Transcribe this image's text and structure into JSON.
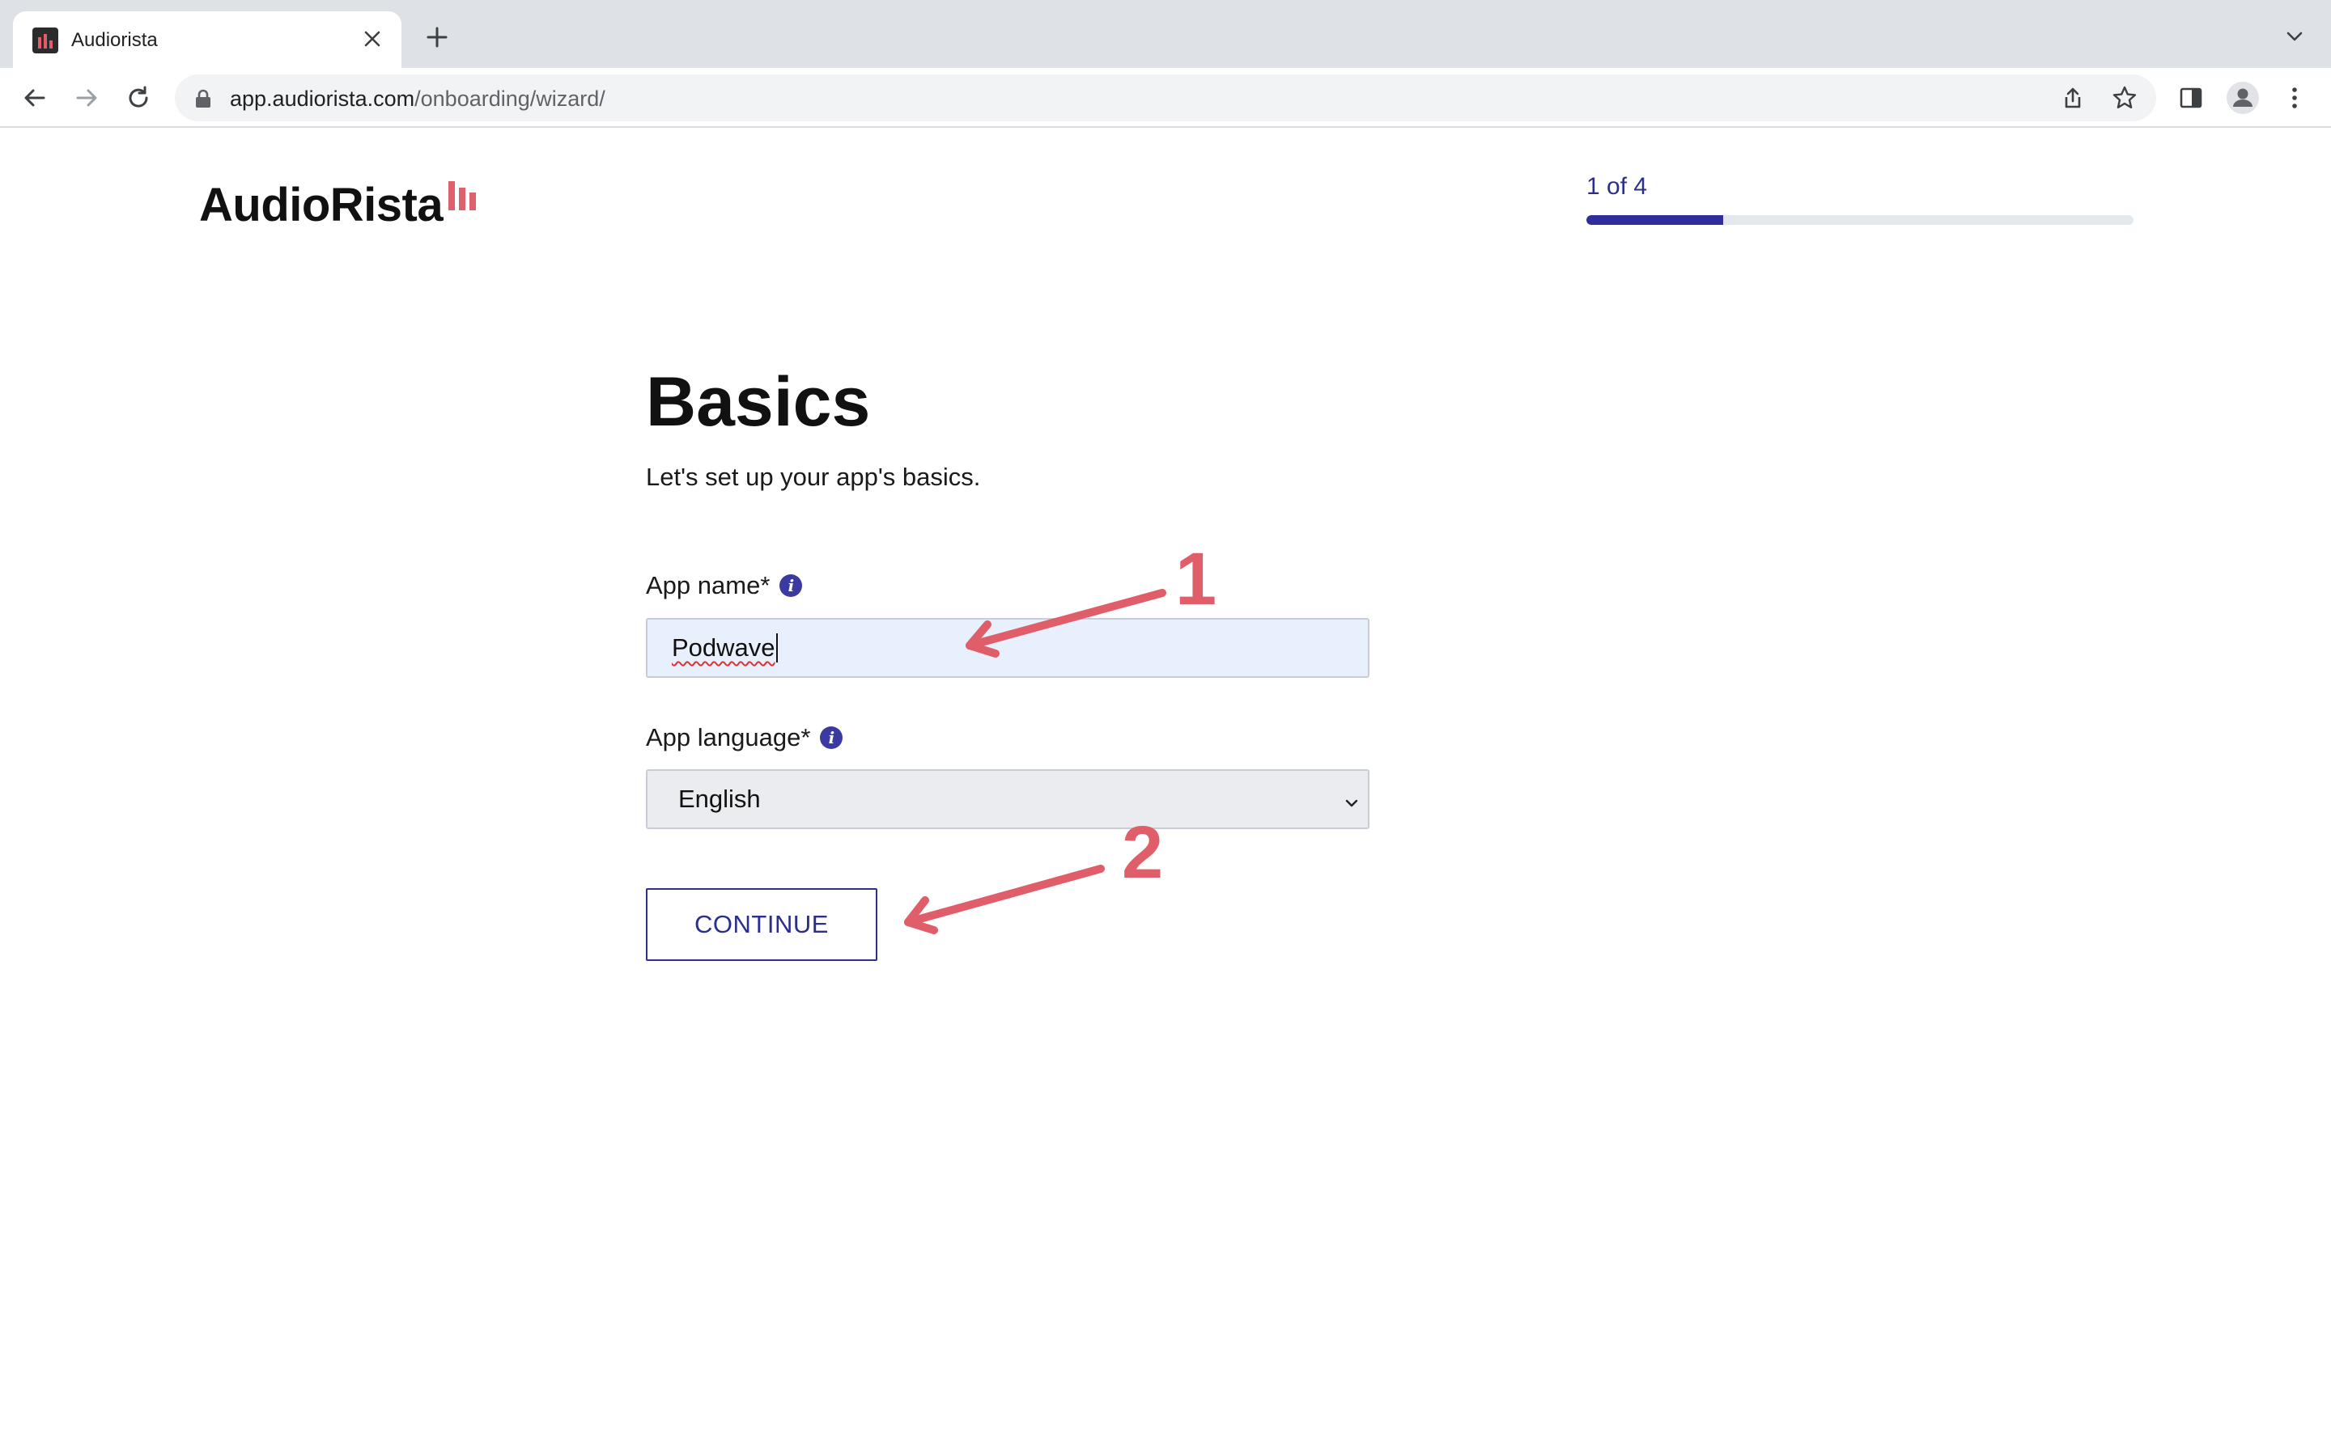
{
  "browser": {
    "tab_title": "Audiorista",
    "url_host": "app.audiorista.com",
    "url_path": "/onboarding/wizard/"
  },
  "page": {
    "logo_text": "AudioRista",
    "progress": {
      "label": "1 of 4",
      "current_step": 1,
      "total_steps": 4,
      "fraction": 0.25
    },
    "title": "Basics",
    "subtitle": "Let's set up your app's basics.",
    "app_name": {
      "label": "App name*",
      "value": "Podwave"
    },
    "app_language": {
      "label": "App language*",
      "selected": "English"
    },
    "continue_label": "CONTINUE"
  },
  "annotations": [
    {
      "number": "1",
      "target": "app-name-input"
    },
    {
      "number": "2",
      "target": "continue-button"
    }
  ],
  "colors": {
    "accent": "#2f2f9a",
    "annotation": "#e05e6a",
    "logo_mark": "#e0616e",
    "input_bg": "#e8f0fe"
  }
}
